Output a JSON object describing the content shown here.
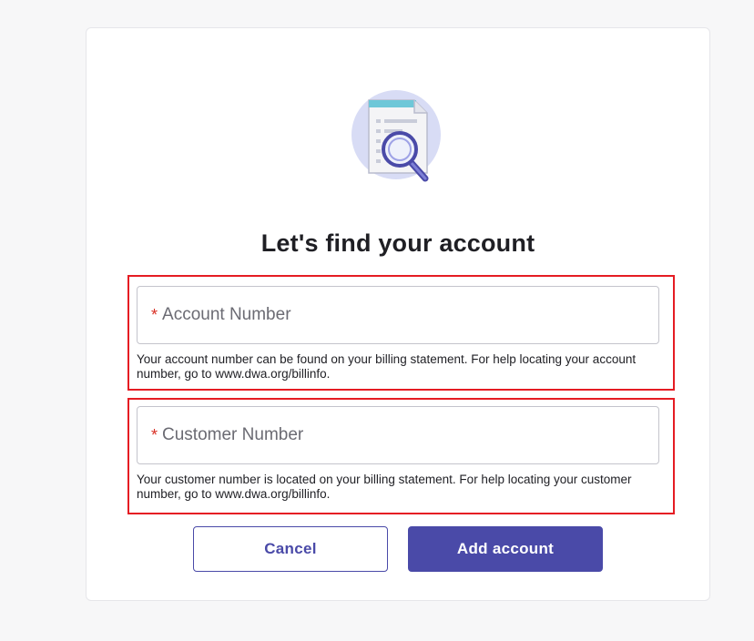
{
  "page": {
    "title": "Let's find your account"
  },
  "form": {
    "account_number": {
      "required_marker": "*",
      "placeholder": "Account Number",
      "value": "",
      "help_text": "Your account number can be found on your billing statement. For help locating your account number, go to www.dwa.org/billinfo."
    },
    "customer_number": {
      "required_marker": "*",
      "placeholder": "Customer Number",
      "value": "",
      "help_text": "Your customer number is located on your billing statement. For help locating your customer number, go to www.dwa.org/billinfo."
    }
  },
  "actions": {
    "cancel_label": "Cancel",
    "add_label": "Add account"
  },
  "icons": {
    "illustration": "document-search-icon"
  },
  "colors": {
    "primary": "#4a4aa8",
    "required": "#d93025",
    "highlight": "#e51c23",
    "illustration_circle": "#d8dcf5",
    "illustration_header": "#6ec7d8"
  }
}
